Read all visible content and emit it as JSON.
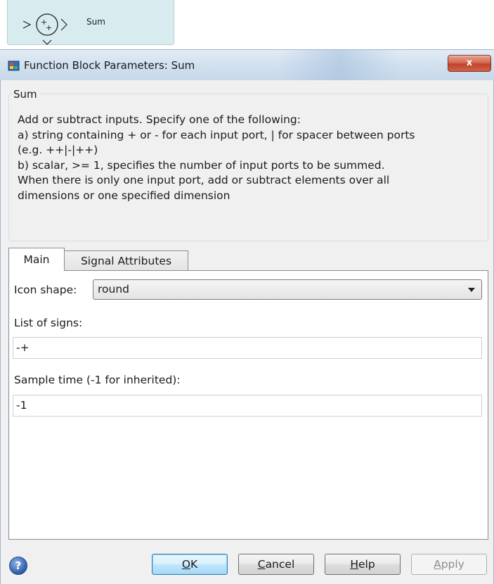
{
  "block": {
    "name": "Sum",
    "icon": "sum-block-icon"
  },
  "window": {
    "title": "Function Block Parameters: Sum",
    "close_label": "x",
    "icon": "simulink-block-icon"
  },
  "group": {
    "legend": "Sum",
    "description_lines": [
      "Add or subtract inputs.  Specify one of the following:",
      "a) string containing + or - for each input port, | for spacer between ports",
      "(e.g. ++|-|++)",
      "b) scalar, >= 1, specifies the number of input ports to be summed.",
      "When there is only one input port, add or subtract elements over all",
      "dimensions or one specified dimension"
    ]
  },
  "tabs": [
    {
      "label": "Main",
      "selected": true
    },
    {
      "label": "Signal Attributes",
      "selected": false
    }
  ],
  "main": {
    "icon_shape_label": "Icon shape:",
    "icon_shape_value": "round",
    "list_of_signs_label": "List of signs:",
    "list_of_signs_value": "-+",
    "sample_time_label": "Sample time (-1 for inherited):",
    "sample_time_value": "-1"
  },
  "buttons": {
    "ok": {
      "rest": "K",
      "mnemonic": "O"
    },
    "cancel": {
      "rest": "ancel",
      "mnemonic": "C"
    },
    "help": {
      "rest": "elp",
      "mnemonic": "H"
    },
    "apply": {
      "rest": "pply",
      "mnemonic": "A",
      "enabled": false
    },
    "help_icon": "question-mark-icon"
  },
  "colors": {
    "title_bar": "#d3e1ef",
    "close_button": "#c2432a",
    "ok_button_border": "#3c7fb1"
  }
}
